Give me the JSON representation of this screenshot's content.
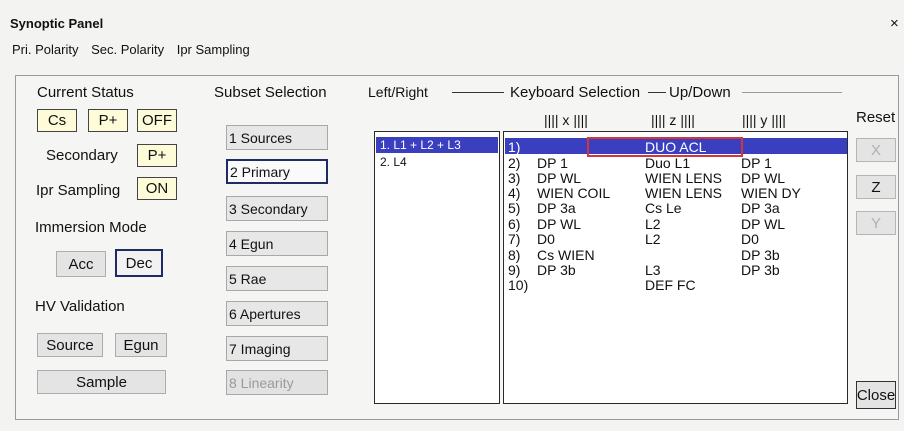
{
  "window": {
    "title": "Synoptic Panel",
    "close_glyph": "×"
  },
  "menu": [
    "Pri. Polarity",
    "Sec. Polarity",
    "Ipr Sampling"
  ],
  "status": {
    "heading": "Current Status",
    "primary": [
      "Cs",
      "P+",
      "OFF"
    ],
    "secondary_label": "Secondary",
    "secondary_value": "P+",
    "ipr_label": "Ipr Sampling",
    "ipr_value": "ON"
  },
  "immersion": {
    "heading": "Immersion Mode",
    "acc": "Acc",
    "dec": "Dec"
  },
  "hv": {
    "heading": "HV Validation",
    "source": "Source",
    "egun": "Egun",
    "sample": "Sample"
  },
  "subset": {
    "heading": "Subset Selection",
    "items": [
      "1 Sources",
      "2 Primary",
      "3 Secondary",
      "4 Egun",
      "5 Rae",
      "6 Apertures",
      "7 Imaging",
      "8 Linearity"
    ]
  },
  "left_right": {
    "heading": "Left/Right",
    "items": [
      "1. L1 + L2 + L3",
      "2. L4"
    ]
  },
  "keyboard": {
    "heading": "Keyboard Selection",
    "updown": "Up/Down",
    "col_x": "|||| x ||||",
    "col_z": "|||| z ||||",
    "col_y": "|||| y ||||",
    "rows": [
      {
        "n": "1)",
        "x": "",
        "z": "DUO ACL",
        "y": ""
      },
      {
        "n": "2)",
        "x": "DP 1",
        "z": "Duo L1",
        "y": "DP 1"
      },
      {
        "n": "3)",
        "x": "DP WL",
        "z": "WIEN LENS",
        "y": "DP WL"
      },
      {
        "n": "4)",
        "x": "WIEN COIL",
        "z": "WIEN LENS",
        "y": "WIEN DY"
      },
      {
        "n": "5)",
        "x": "DP 3a",
        "z": "Cs Le",
        "y": "DP 3a"
      },
      {
        "n": "6)",
        "x": "DP WL",
        "z": "L2",
        "y": "DP WL"
      },
      {
        "n": "7)",
        "x": "D0",
        "z": "L2",
        "y": "D0"
      },
      {
        "n": "8)",
        "x": "Cs WIEN",
        "z": "",
        "y": "DP 3b"
      },
      {
        "n": "9)",
        "x": "DP 3b",
        "z": "L3",
        "y": "DP 3b"
      },
      {
        "n": "10)",
        "x": "",
        "z": "DEF FC",
        "y": ""
      }
    ]
  },
  "side": {
    "reset": "Reset",
    "x": "X",
    "z": "Z",
    "y": "Y",
    "close": "Close"
  }
}
